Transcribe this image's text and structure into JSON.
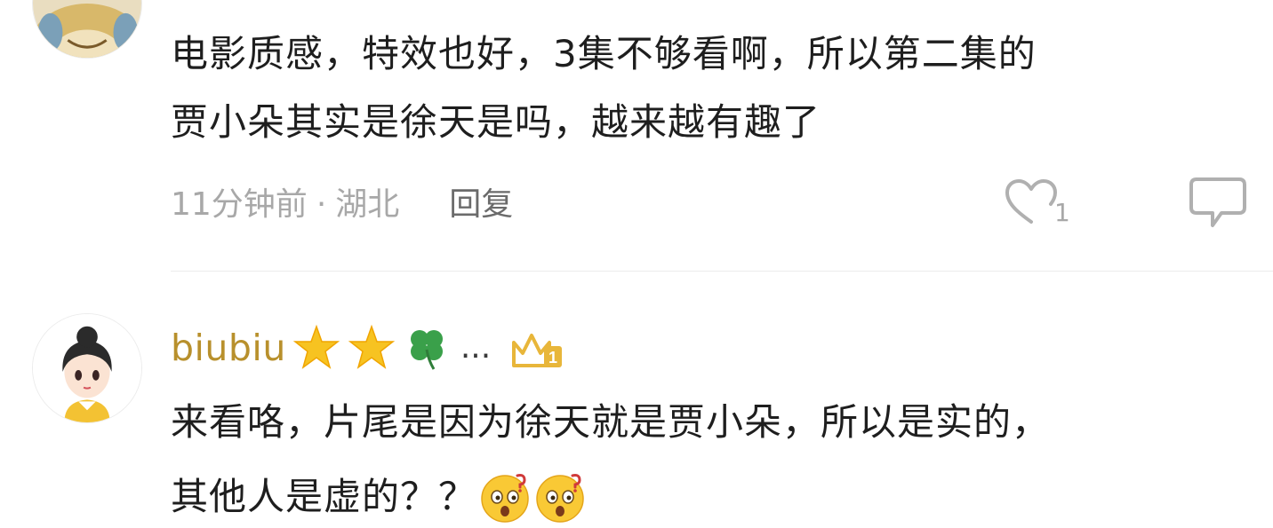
{
  "comments": [
    {
      "avatar": "cartoon-bird-avatar",
      "text_lines": [
        "电影质感，特效也好，3集不够看啊，所以第二集的",
        "贾小朵其实是徐天是吗，越来越有趣了"
      ],
      "time": "11分钟前",
      "separator": "·",
      "location": "湖北",
      "reply_label": "回复",
      "like_count": "1",
      "like_icon": "heart-outline-icon",
      "comment_icon": "speech-bubble-icon"
    },
    {
      "avatar": "anime-girl-avatar",
      "username": "biubiu",
      "username_emojis": [
        "star-emoji",
        "star-emoji",
        "four-leaf-clover-emoji"
      ],
      "username_ellipsis": "...",
      "badge": "crown-level-1-badge",
      "text_lines": [
        "来看咯，片尾是因为徐天就是贾小朵，所以是实的，",
        "其他人是虚的？？"
      ],
      "text_emojis": [
        "confused-face-emoji",
        "confused-face-emoji"
      ]
    }
  ],
  "colors": {
    "username": "#b8902c",
    "meta_text": "#a8a8a8",
    "reply_text": "#6b6b6b",
    "body_text": "#1e1e1e",
    "divider": "#ececec"
  }
}
